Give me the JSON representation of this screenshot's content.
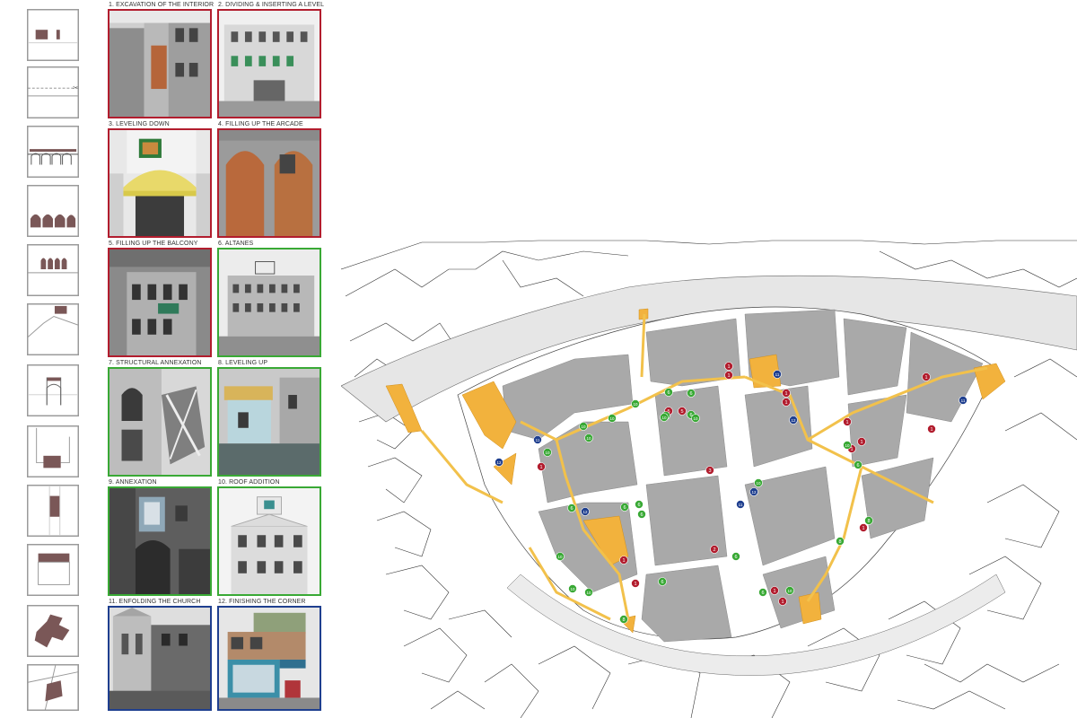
{
  "colors": {
    "red": "#b21d2e",
    "green": "#39a935",
    "blue": "#1f3f8f",
    "highlight": "#f2b23d",
    "building": "#a9a9a9",
    "water": "#e6e6e6"
  },
  "cases": [
    {
      "label": "1. EXCAVATION OF THE INTERIOR",
      "color": "red"
    },
    {
      "label": "2. DIVIDING & INSERTING A LEVEL",
      "color": "red"
    },
    {
      "label": "3. LEVELING DOWN",
      "color": "red"
    },
    {
      "label": "4. FILLING UP THE ARCADE",
      "color": "red"
    },
    {
      "label": "5. FILLING UP THE BALCONY",
      "color": "red"
    },
    {
      "label": "6. ALTANES",
      "color": "green"
    },
    {
      "label": "7. STRUCTURAL ANNEXATION",
      "color": "green"
    },
    {
      "label": "8. LEVELING UP",
      "color": "green"
    },
    {
      "label": "9.  ANNEXATION",
      "color": "green"
    },
    {
      "label": "10. ROOF ADDITION",
      "color": "green"
    },
    {
      "label": "11. ENFOLDING THE CHURCH",
      "color": "blue"
    },
    {
      "label": "12. FINISHING THE CORNER",
      "color": "blue"
    }
  ],
  "diagrams": [
    "excavation-diagram",
    "dividing-diagram",
    "leveling-down-diagram",
    "arcade-diagram",
    "balcony-diagram",
    "altane-diagram",
    "structural-annexation-diagram",
    "leveling-up-diagram",
    "annexation-diagram",
    "roof-addition-diagram",
    "enfolding-church-diagram",
    "corner-diagram"
  ],
  "map_markers": [
    {
      "n": "1",
      "c": "red"
    },
    {
      "n": "1",
      "c": "red"
    },
    {
      "n": "1",
      "c": "red"
    },
    {
      "n": "1",
      "c": "red"
    },
    {
      "n": "1",
      "c": "red"
    },
    {
      "n": "1",
      "c": "red"
    },
    {
      "n": "1",
      "c": "red"
    },
    {
      "n": "1",
      "c": "red"
    },
    {
      "n": "1",
      "c": "red"
    },
    {
      "n": "1",
      "c": "red"
    },
    {
      "n": "1",
      "c": "red"
    },
    {
      "n": "1",
      "c": "red"
    },
    {
      "n": "1",
      "c": "red"
    },
    {
      "n": "1",
      "c": "red"
    },
    {
      "n": "1",
      "c": "red"
    },
    {
      "n": "2",
      "c": "red"
    },
    {
      "n": "3",
      "c": "red"
    },
    {
      "n": "5",
      "c": "red"
    },
    {
      "n": "5",
      "c": "red"
    },
    {
      "n": "6",
      "c": "green"
    },
    {
      "n": "6",
      "c": "green"
    },
    {
      "n": "6",
      "c": "green"
    },
    {
      "n": "6",
      "c": "green"
    },
    {
      "n": "6",
      "c": "green"
    },
    {
      "n": "6",
      "c": "green"
    },
    {
      "n": "6",
      "c": "green"
    },
    {
      "n": "6",
      "c": "green"
    },
    {
      "n": "6",
      "c": "green"
    },
    {
      "n": "6",
      "c": "green"
    },
    {
      "n": "6",
      "c": "green"
    },
    {
      "n": "6",
      "c": "green"
    },
    {
      "n": "8",
      "c": "green"
    },
    {
      "n": "8",
      "c": "green"
    },
    {
      "n": "8",
      "c": "green"
    },
    {
      "n": "10",
      "c": "green"
    },
    {
      "n": "10",
      "c": "green"
    },
    {
      "n": "10",
      "c": "green"
    },
    {
      "n": "10",
      "c": "green"
    },
    {
      "n": "10",
      "c": "green"
    },
    {
      "n": "10",
      "c": "green"
    },
    {
      "n": "10",
      "c": "green"
    },
    {
      "n": "10",
      "c": "green"
    },
    {
      "n": "10",
      "c": "green"
    },
    {
      "n": "10",
      "c": "green"
    },
    {
      "n": "10",
      "c": "green"
    },
    {
      "n": "10",
      "c": "green"
    },
    {
      "n": "10",
      "c": "green"
    },
    {
      "n": "11",
      "c": "blue"
    },
    {
      "n": "11",
      "c": "blue"
    },
    {
      "n": "11",
      "c": "blue"
    },
    {
      "n": "11",
      "c": "blue"
    },
    {
      "n": "12",
      "c": "blue"
    },
    {
      "n": "12",
      "c": "blue"
    },
    {
      "n": "12",
      "c": "blue"
    },
    {
      "n": "12",
      "c": "blue"
    }
  ]
}
